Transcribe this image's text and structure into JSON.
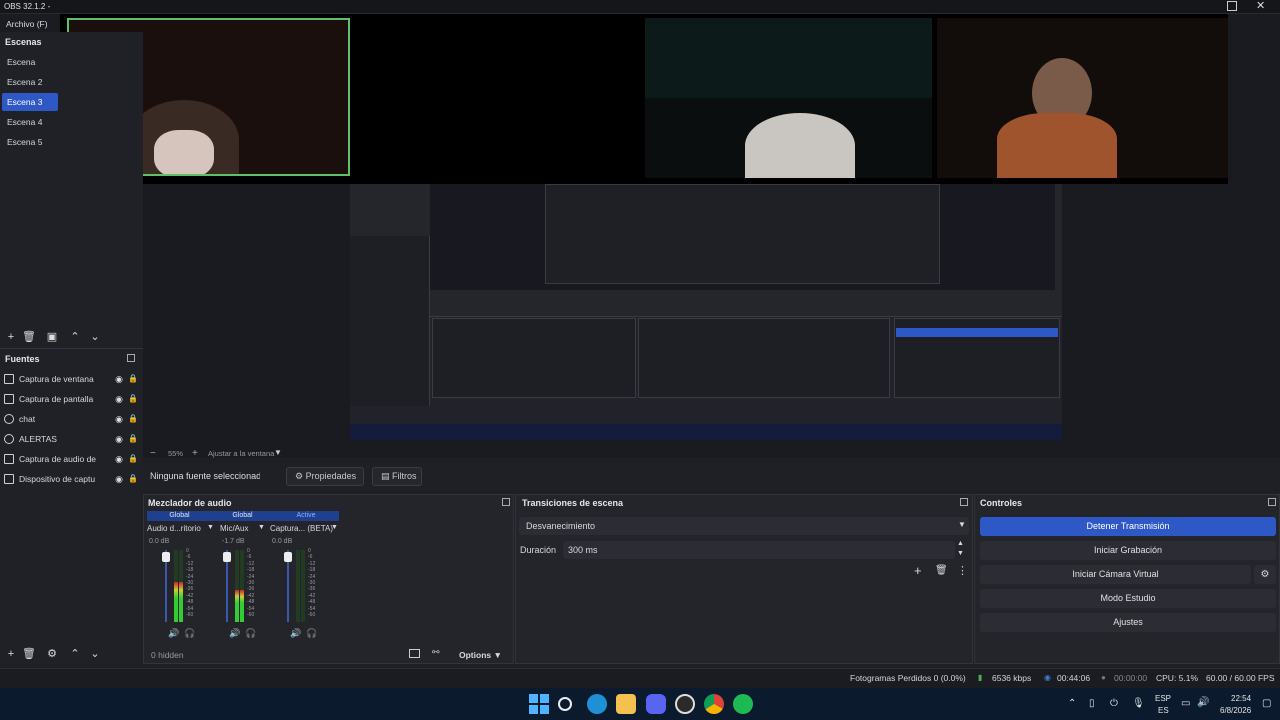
{
  "window": {
    "title": "OBS 32.1.2 -",
    "menu_archivo": "Archivo (F)"
  },
  "scenes": {
    "header": "Escenas",
    "items": [
      "Escena",
      "Escena 2",
      "Escena 3",
      "Escena 4",
      "Escena 5"
    ],
    "active": "Escena 3"
  },
  "sources": {
    "header": "Fuentes",
    "items": [
      "Captura de ventana",
      "Captura de pantalla",
      "chat",
      "ALERTAS",
      "Captura de audio de",
      "Dispositivo de captu"
    ]
  },
  "preview": {
    "zoom": "55%",
    "fit_label": "Ajustar a la ventana"
  },
  "properties_bar": {
    "no_source": "Ninguna fuente seleccionad",
    "properties": "Propiedades",
    "filters": "Filtros"
  },
  "mixer": {
    "title": "Mezclador de audio",
    "channels": [
      {
        "tag": "Global",
        "name": "Audio d...ritorio",
        "db": "0.0 dB",
        "level": 0.55
      },
      {
        "tag": "Global",
        "name": "Mic/Aux",
        "db": "-1.7 dB",
        "level": 0.45
      },
      {
        "tag": "Active",
        "name": "Captura... (BETA)",
        "db": "0.0 dB",
        "level": 0.0
      }
    ],
    "scale": [
      "0",
      "-6",
      "-12",
      "-18",
      "-24",
      "-30",
      "-36",
      "-42",
      "-48",
      "-54",
      "-60"
    ],
    "hidden": "0 hidden",
    "options": "Options"
  },
  "transitions": {
    "title": "Transiciones de escena",
    "selected": "Desvanecimiento",
    "duration_label": "Duración",
    "duration_value": "300 ms"
  },
  "controls": {
    "title": "Controles",
    "stop_stream": "Detener Transmisión",
    "start_recording": "Iniciar Grabación",
    "virtual_cam": "Iniciar Cámara Virtual",
    "studio_mode": "Modo Estudio",
    "settings": "Ajustes"
  },
  "status": {
    "dropped": "Fotogramas Perdidos 0 (0.0%)",
    "bitrate": "6536 kbps",
    "stream_time": "00:44:06",
    "rec_time": "00:00:00",
    "cpu": "CPU: 5.1%",
    "fps": "60.00 / 60.00 FPS"
  },
  "taskbar": {
    "lang_top": "ESP",
    "lang_bottom": "ES",
    "time": "22:54",
    "date": "6/8/2026"
  },
  "colors": {
    "accent": "#2f58c7",
    "green_border": "#5fbf6a"
  }
}
